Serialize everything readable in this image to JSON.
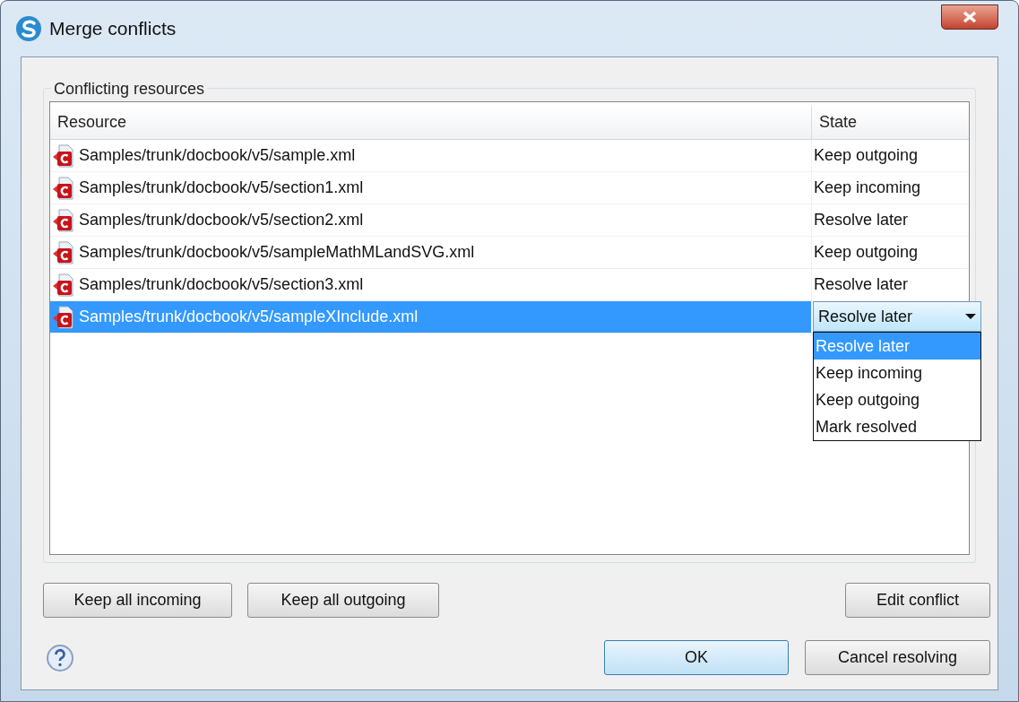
{
  "window": {
    "title": "Merge conflicts"
  },
  "group": {
    "title": "Conflicting resources"
  },
  "table": {
    "columns": [
      "Resource",
      "State"
    ],
    "rows": [
      {
        "resource": "Samples/trunk/docbook/v5/sample.xml",
        "state": "Keep outgoing",
        "selected": false
      },
      {
        "resource": "Samples/trunk/docbook/v5/section1.xml",
        "state": "Keep incoming",
        "selected": false
      },
      {
        "resource": "Samples/trunk/docbook/v5/section2.xml",
        "state": "Resolve later",
        "selected": false
      },
      {
        "resource": "Samples/trunk/docbook/v5/sampleMathMLandSVG.xml",
        "state": "Keep outgoing",
        "selected": false
      },
      {
        "resource": "Samples/trunk/docbook/v5/section3.xml",
        "state": "Resolve later",
        "selected": false
      },
      {
        "resource": "Samples/trunk/docbook/v5/sampleXInclude.xml",
        "state": "Resolve later",
        "selected": true
      }
    ],
    "state_editor": {
      "options": [
        {
          "label": "Resolve later",
          "selected": true
        },
        {
          "label": "Keep incoming",
          "selected": false
        },
        {
          "label": "Keep outgoing",
          "selected": false
        },
        {
          "label": "Mark resolved",
          "selected": false
        }
      ]
    }
  },
  "actions_left": [
    "Keep all incoming",
    "Keep all outgoing"
  ],
  "action_right": "Edit conflict",
  "buttons": [
    {
      "label": "OK",
      "kind": "default"
    },
    {
      "label": "Cancel resolving",
      "kind": "normal"
    }
  ]
}
